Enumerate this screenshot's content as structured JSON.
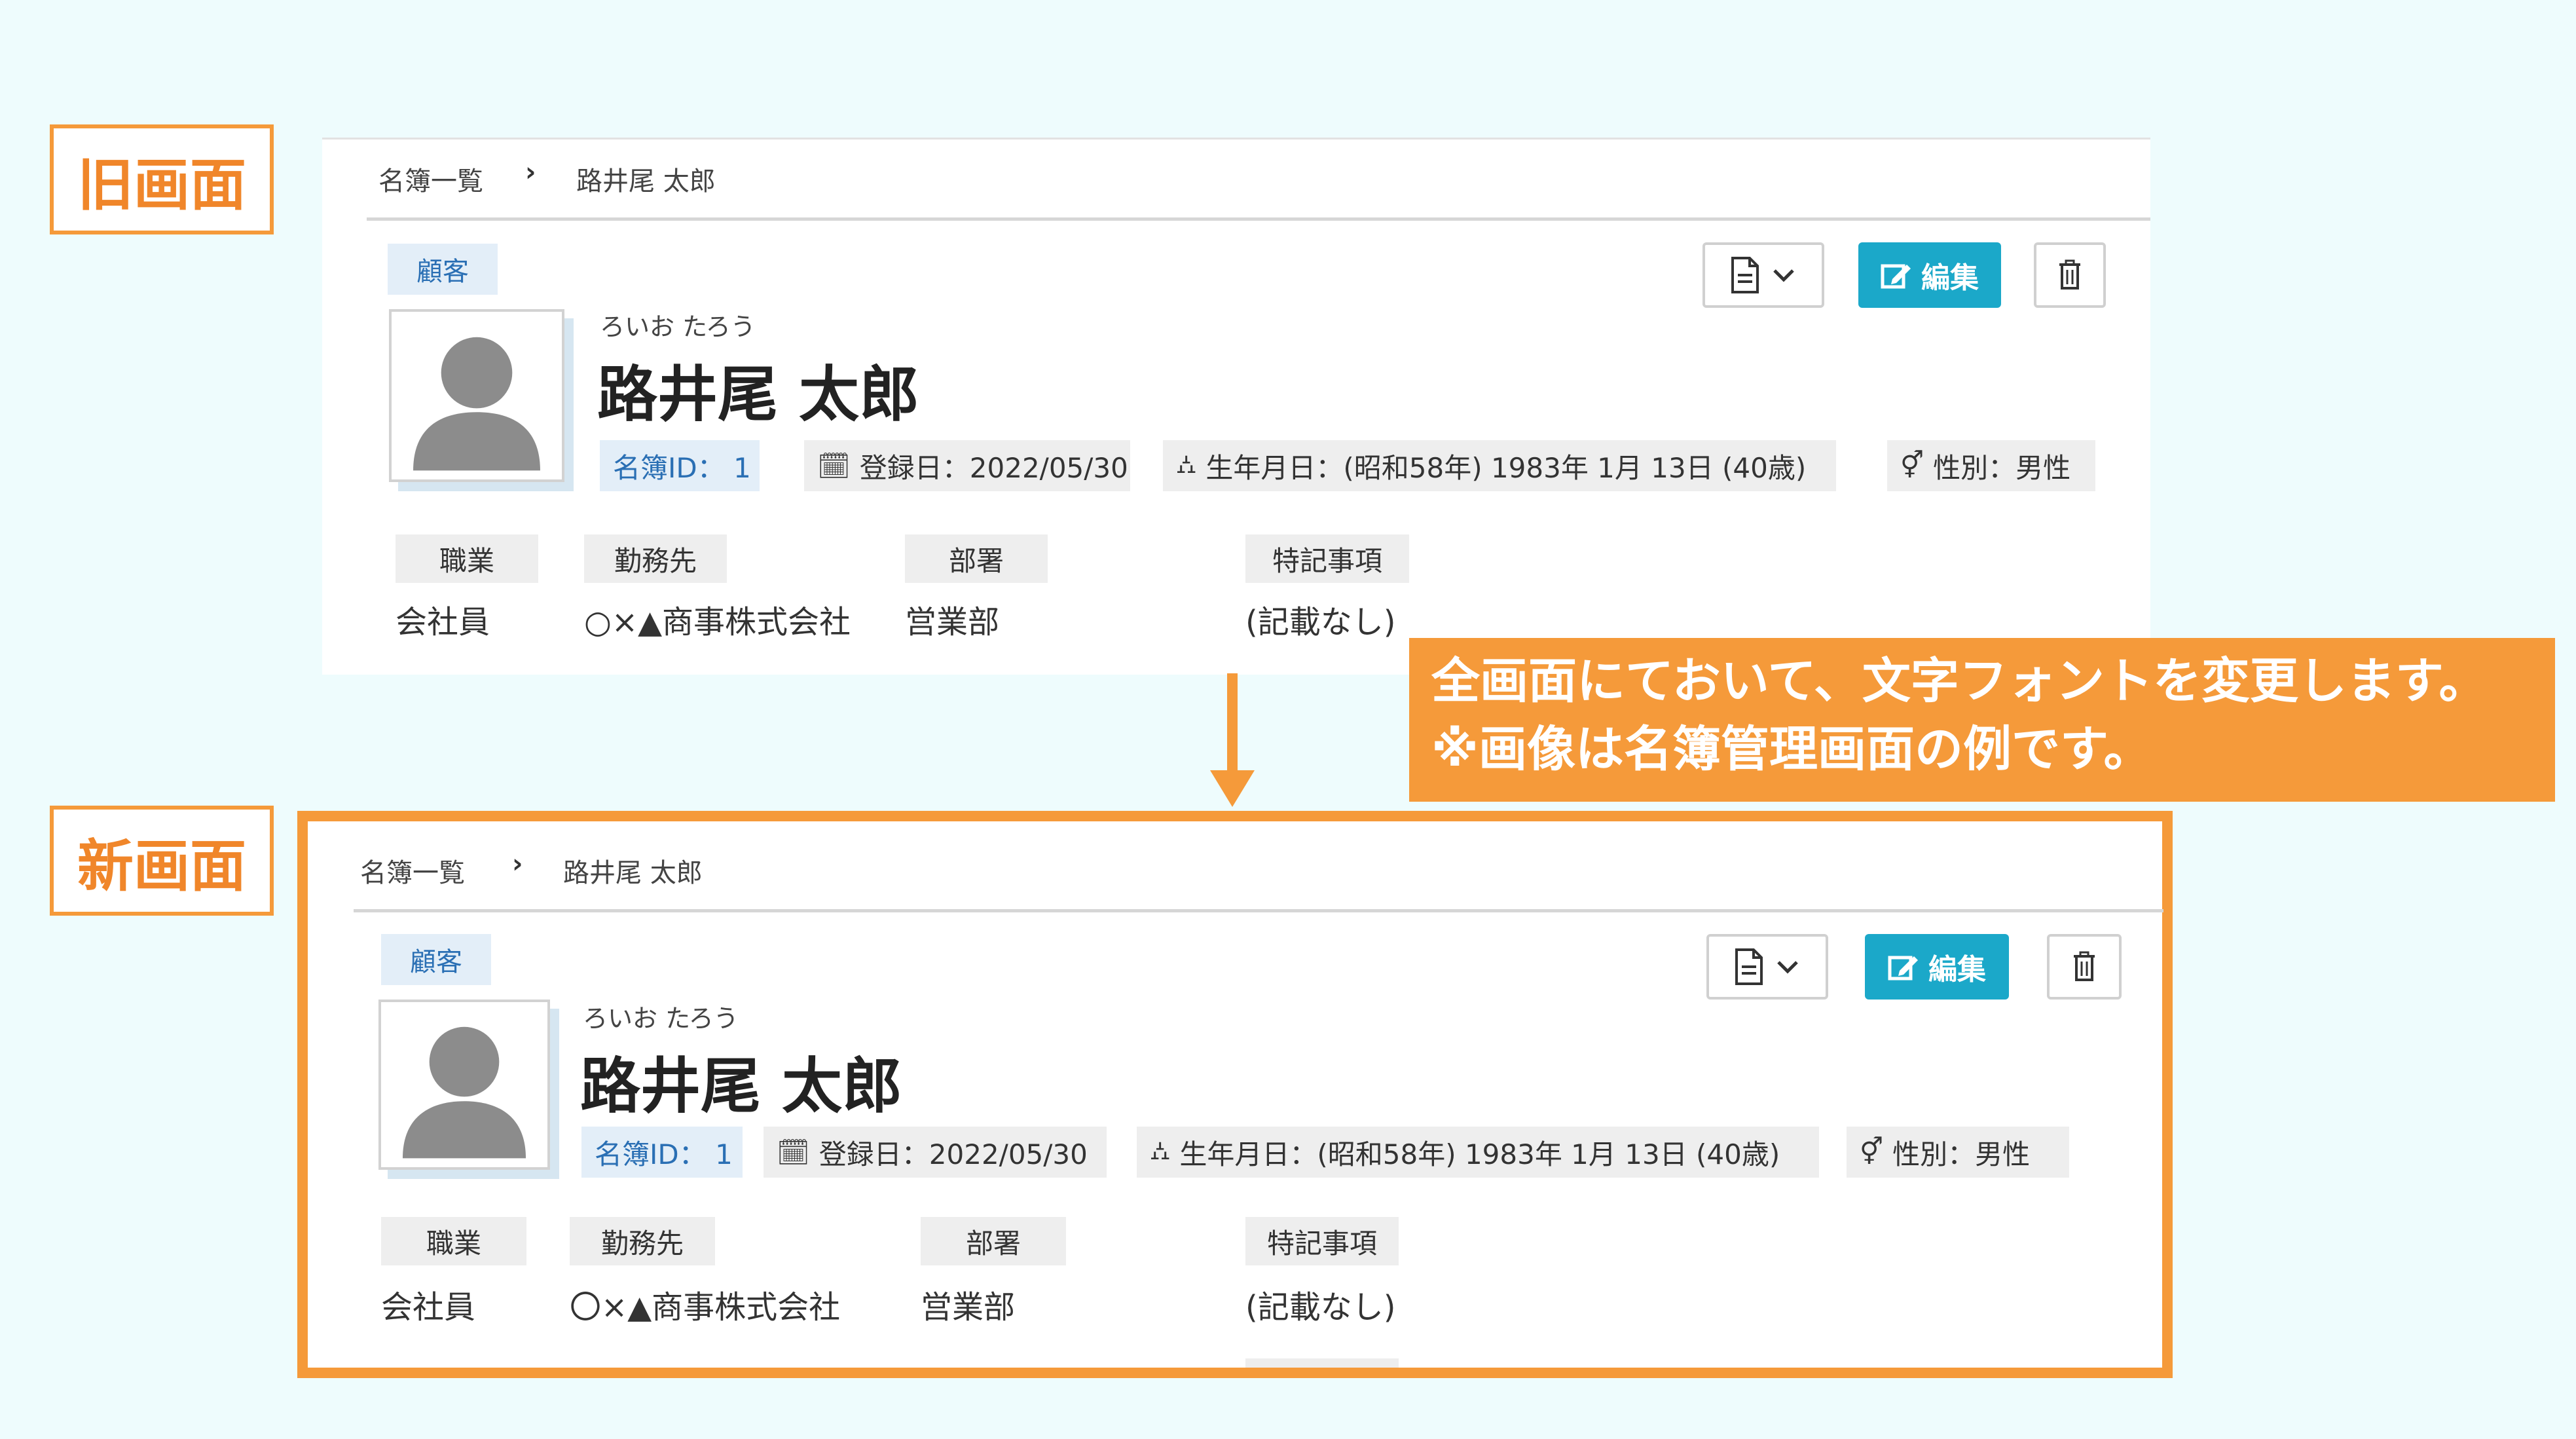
{
  "labels": {
    "old_screen": "旧画面",
    "new_screen": "新画面"
  },
  "callout": {
    "line1": "全画面にておいて、文字フォントを変更します。",
    "line2": "※画像は名簿管理画面の例です。"
  },
  "colors": {
    "accent_orange": "#f59a3a",
    "primary_button": "#1ba8c9",
    "tag_blue_bg": "#e3eef8",
    "tag_blue_text": "#2a6fb4"
  },
  "old": {
    "breadcrumb": {
      "root": "名簿一覧",
      "separator": "›",
      "current": "路井尾 太郎"
    },
    "category_tag": "顧客",
    "buttons": {
      "doc_icon": "document-icon",
      "edit_label": "編集",
      "delete_icon": "trash-icon"
    },
    "person": {
      "kana": "ろいお たろう",
      "name": "路井尾 太郎"
    },
    "chips": {
      "id": "名簿ID： 1",
      "registered": "登録日：2022/05/30",
      "birthday": "生年月日：(昭和58年) 1983年 1月 13日 (40歳)",
      "gender": "性別：男性"
    },
    "fields": [
      {
        "label": "職業",
        "value": "会社員"
      },
      {
        "label": "勤務先",
        "value": "○×▲商事株式会社"
      },
      {
        "label": "部署",
        "value": "営業部"
      },
      {
        "label": "特記事項",
        "value": "(記載なし)"
      }
    ]
  },
  "new": {
    "breadcrumb": {
      "root": "名簿一覧",
      "separator": "›",
      "current": "路井尾 太郎"
    },
    "category_tag": "顧客",
    "buttons": {
      "doc_icon": "document-icon",
      "edit_label": "編集",
      "delete_icon": "trash-icon"
    },
    "person": {
      "kana": "ろいお たろう",
      "name": "路井尾 太郎"
    },
    "chips": {
      "id": "名簿ID： 1",
      "registered": "登録日：2022/05/30",
      "birthday": "生年月日：(昭和58年) 1983年 1月 13日 (40歳)",
      "gender": "性別：男性"
    },
    "fields": [
      {
        "label": "職業",
        "value": "会社員"
      },
      {
        "label": "勤務先",
        "value": "〇×▲商事株式会社"
      },
      {
        "label": "部署",
        "value": "営業部"
      },
      {
        "label": "特記事項",
        "value": "(記載なし)"
      }
    ]
  }
}
